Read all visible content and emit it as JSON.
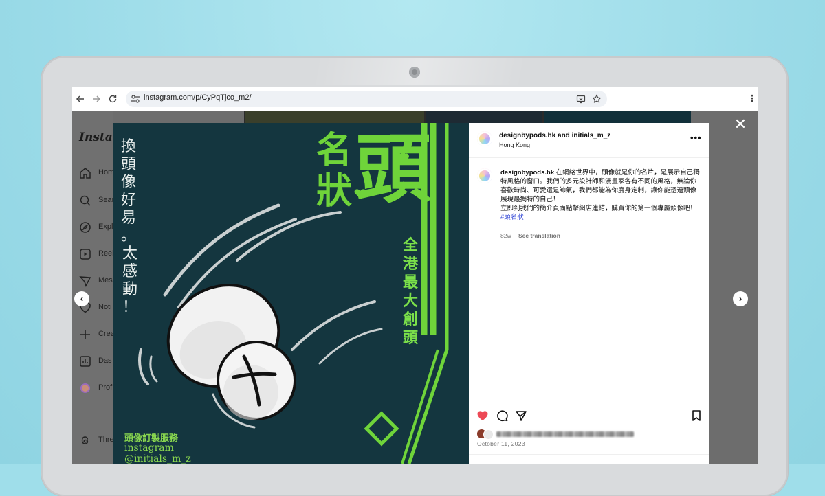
{
  "browser": {
    "url": "instagram.com/p/CyPqTjco_m2/"
  },
  "instagram": {
    "logo": "Instagr",
    "sidebar": [
      {
        "label": "Hom",
        "icon": "home-icon"
      },
      {
        "label": "Sear",
        "icon": "search-icon"
      },
      {
        "label": "Expl",
        "icon": "explore-icon"
      },
      {
        "label": "Reel",
        "icon": "reels-icon"
      },
      {
        "label": "Mes",
        "icon": "messages-icon"
      },
      {
        "label": "Noti",
        "icon": "heart-icon"
      },
      {
        "label": "Crea",
        "icon": "plus-icon"
      },
      {
        "label": "Das",
        "icon": "dashboard-icon"
      },
      {
        "label": "Prof",
        "icon": "profile-icon"
      },
      {
        "label": "Thre",
        "icon": "threads-icon"
      }
    ]
  },
  "post": {
    "authors": "designbypods.hk and initials_m_z",
    "location": "Hong Kong",
    "caption_user": "designbypods.hk",
    "caption_text": "在網絡世界中，頭像就是你的名片，是展示自己獨特風格的窗口。我們的多元設計師和漫畫家各有不同的風格，無論你喜歡時尚、可愛還是帥氣，我們都能為你度身定制，讓你能透過頭像展現最獨特的自己！",
    "caption_text2": "立即到我們的簡介頁面點擊網店連結，購買你的第一個專屬頭像吧！",
    "hashtag": "#頭名狀",
    "age": "82w",
    "see_translation": "See translation",
    "date": "October 11, 2023",
    "liked": true
  },
  "artwork": {
    "poem_col1": [
      "換",
      "頭",
      "像",
      "好",
      "易",
      "。"
    ],
    "poem_col2": [
      "太",
      "感",
      "動",
      "！"
    ],
    "title_left": "名狀",
    "title_right": "頭",
    "vertical_title": [
      "全",
      "港",
      "最",
      "大",
      "創",
      "頭"
    ],
    "service_title": "頭像訂製服務",
    "service_platform": "instagram",
    "service_handle": "@initials_m_z"
  },
  "colors": {
    "artwork_bg": "#14363f",
    "artwork_green": "#6fd43a",
    "like_red": "#ed4956",
    "hashtag_blue": "#3b4fd8"
  }
}
